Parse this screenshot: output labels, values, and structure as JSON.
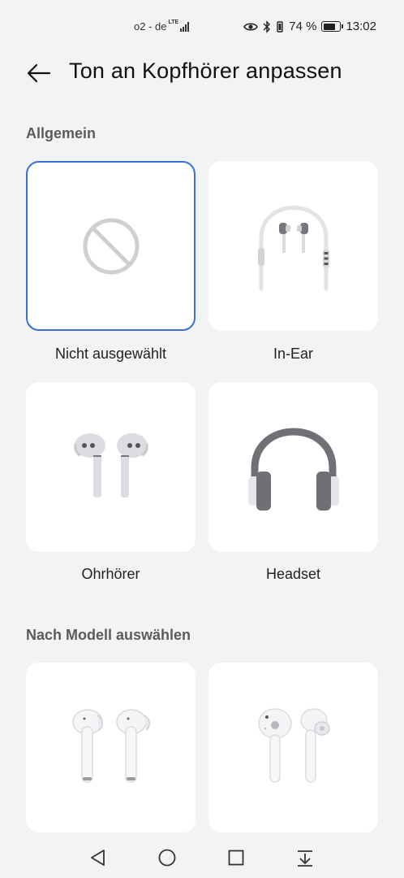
{
  "status_bar": {
    "carrier": "o2 - de",
    "network_type": "LTE",
    "battery_percent": "74 %",
    "battery_level": 0.74,
    "time": "13:02",
    "icons": [
      "signal-icon",
      "eye-icon",
      "bluetooth-icon",
      "vibrate-icon",
      "battery-icon"
    ]
  },
  "header": {
    "title": "Ton an Kopfhörer anpassen",
    "back_icon": "back-arrow-icon"
  },
  "sections": {
    "general": {
      "title": "Allgemein",
      "items": [
        {
          "label": "Nicht ausgewählt",
          "icon": "not-selected-icon",
          "selected": true
        },
        {
          "label": "In-Ear",
          "icon": "in-ear-headphones-icon",
          "selected": false
        },
        {
          "label": "Ohrhörer",
          "icon": "earbuds-icon",
          "selected": false
        },
        {
          "label": "Headset",
          "icon": "headset-icon",
          "selected": false
        }
      ]
    },
    "by_model": {
      "title": "Nach Modell auswählen",
      "items": [
        {
          "label": "",
          "icon": "model-earbuds-1-icon"
        },
        {
          "label": "",
          "icon": "model-earbuds-2-icon"
        }
      ]
    }
  },
  "colors": {
    "background": "#f1f3f5",
    "card": "#ffffff",
    "selection_border": "#3b6fd4",
    "section_title": "#5b5b5b"
  },
  "nav_bar": {
    "icons": [
      "nav-back-icon",
      "nav-home-icon",
      "nav-recents-icon",
      "nav-notification-icon"
    ]
  }
}
